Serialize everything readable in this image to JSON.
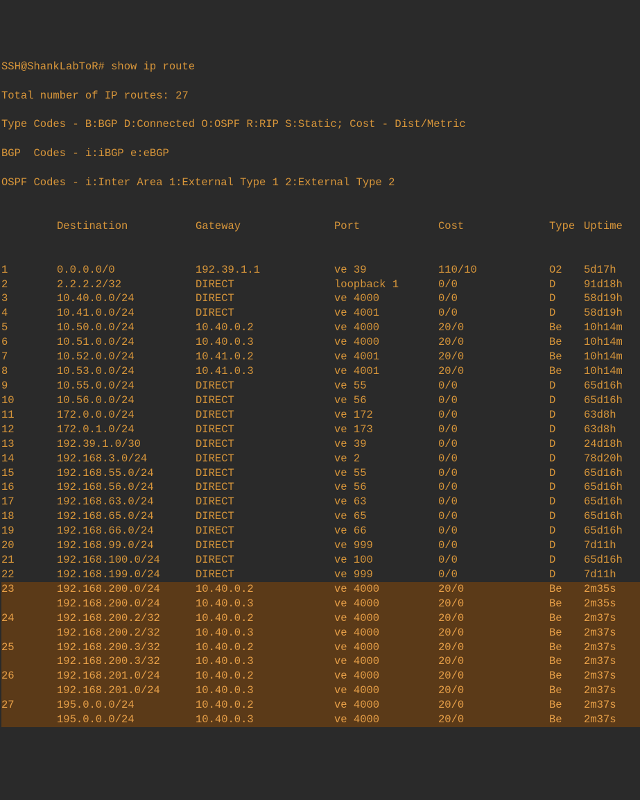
{
  "prompt": "SSH@ShankLabToR# show ip route",
  "header": [
    "Total number of IP routes: 27",
    "Type Codes - B:BGP D:Connected O:OSPF R:RIP S:Static; Cost - Dist/Metric",
    "BGP  Codes - i:iBGP e:eBGP",
    "OSPF Codes - i:Inter Area 1:External Type 1 2:External Type 2"
  ],
  "columns": {
    "idx": "",
    "dest": "Destination",
    "gw": "Gateway",
    "port": "Port",
    "cost": "Cost",
    "type": "Type",
    "up": "Uptime"
  },
  "routes": [
    {
      "idx": "1",
      "dest": "0.0.0.0/0",
      "gw": "192.39.1.1",
      "port": "ve 39",
      "cost": "110/10",
      "type": "O2",
      "up": "5d17h",
      "hl": false
    },
    {
      "idx": "2",
      "dest": "2.2.2.2/32",
      "gw": "DIRECT",
      "port": "loopback 1",
      "cost": "0/0",
      "type": "D",
      "up": "91d18h",
      "hl": false
    },
    {
      "idx": "3",
      "dest": "10.40.0.0/24",
      "gw": "DIRECT",
      "port": "ve 4000",
      "cost": "0/0",
      "type": "D",
      "up": "58d19h",
      "hl": false
    },
    {
      "idx": "4",
      "dest": "10.41.0.0/24",
      "gw": "DIRECT",
      "port": "ve 4001",
      "cost": "0/0",
      "type": "D",
      "up": "58d19h",
      "hl": false
    },
    {
      "idx": "5",
      "dest": "10.50.0.0/24",
      "gw": "10.40.0.2",
      "port": "ve 4000",
      "cost": "20/0",
      "type": "Be",
      "up": "10h14m",
      "hl": false
    },
    {
      "idx": "6",
      "dest": "10.51.0.0/24",
      "gw": "10.40.0.3",
      "port": "ve 4000",
      "cost": "20/0",
      "type": "Be",
      "up": "10h14m",
      "hl": false
    },
    {
      "idx": "7",
      "dest": "10.52.0.0/24",
      "gw": "10.41.0.2",
      "port": "ve 4001",
      "cost": "20/0",
      "type": "Be",
      "up": "10h14m",
      "hl": false
    },
    {
      "idx": "8",
      "dest": "10.53.0.0/24",
      "gw": "10.41.0.3",
      "port": "ve 4001",
      "cost": "20/0",
      "type": "Be",
      "up": "10h14m",
      "hl": false
    },
    {
      "idx": "9",
      "dest": "10.55.0.0/24",
      "gw": "DIRECT",
      "port": "ve 55",
      "cost": "0/0",
      "type": "D",
      "up": "65d16h",
      "hl": false
    },
    {
      "idx": "10",
      "dest": "10.56.0.0/24",
      "gw": "DIRECT",
      "port": "ve 56",
      "cost": "0/0",
      "type": "D",
      "up": "65d16h",
      "hl": false
    },
    {
      "idx": "11",
      "dest": "172.0.0.0/24",
      "gw": "DIRECT",
      "port": "ve 172",
      "cost": "0/0",
      "type": "D",
      "up": "63d8h",
      "hl": false
    },
    {
      "idx": "12",
      "dest": "172.0.1.0/24",
      "gw": "DIRECT",
      "port": "ve 173",
      "cost": "0/0",
      "type": "D",
      "up": "63d8h",
      "hl": false
    },
    {
      "idx": "13",
      "dest": "192.39.1.0/30",
      "gw": "DIRECT",
      "port": "ve 39",
      "cost": "0/0",
      "type": "D",
      "up": "24d18h",
      "hl": false
    },
    {
      "idx": "14",
      "dest": "192.168.3.0/24",
      "gw": "DIRECT",
      "port": "ve 2",
      "cost": "0/0",
      "type": "D",
      "up": "78d20h",
      "hl": false
    },
    {
      "idx": "15",
      "dest": "192.168.55.0/24",
      "gw": "DIRECT",
      "port": "ve 55",
      "cost": "0/0",
      "type": "D",
      "up": "65d16h",
      "hl": false
    },
    {
      "idx": "16",
      "dest": "192.168.56.0/24",
      "gw": "DIRECT",
      "port": "ve 56",
      "cost": "0/0",
      "type": "D",
      "up": "65d16h",
      "hl": false
    },
    {
      "idx": "17",
      "dest": "192.168.63.0/24",
      "gw": "DIRECT",
      "port": "ve 63",
      "cost": "0/0",
      "type": "D",
      "up": "65d16h",
      "hl": false
    },
    {
      "idx": "18",
      "dest": "192.168.65.0/24",
      "gw": "DIRECT",
      "port": "ve 65",
      "cost": "0/0",
      "type": "D",
      "up": "65d16h",
      "hl": false
    },
    {
      "idx": "19",
      "dest": "192.168.66.0/24",
      "gw": "DIRECT",
      "port": "ve 66",
      "cost": "0/0",
      "type": "D",
      "up": "65d16h",
      "hl": false
    },
    {
      "idx": "20",
      "dest": "192.168.99.0/24",
      "gw": "DIRECT",
      "port": "ve 999",
      "cost": "0/0",
      "type": "D",
      "up": "7d11h",
      "hl": false
    },
    {
      "idx": "21",
      "dest": "192.168.100.0/24",
      "gw": "DIRECT",
      "port": "ve 100",
      "cost": "0/0",
      "type": "D",
      "up": "65d16h",
      "hl": false
    },
    {
      "idx": "22",
      "dest": "192.168.199.0/24",
      "gw": "DIRECT",
      "port": "ve 999",
      "cost": "0/0",
      "type": "D",
      "up": "7d11h",
      "hl": false
    },
    {
      "idx": "23",
      "dest": "192.168.200.0/24",
      "gw": "10.40.0.2",
      "port": "ve 4000",
      "cost": "20/0",
      "type": "Be",
      "up": "2m35s",
      "hl": true
    },
    {
      "idx": "",
      "dest": "192.168.200.0/24",
      "gw": "10.40.0.3",
      "port": "ve 4000",
      "cost": "20/0",
      "type": "Be",
      "up": "2m35s",
      "hl": true
    },
    {
      "idx": "24",
      "dest": "192.168.200.2/32",
      "gw": "10.40.0.2",
      "port": "ve 4000",
      "cost": "20/0",
      "type": "Be",
      "up": "2m37s",
      "hl": true
    },
    {
      "idx": "",
      "dest": "192.168.200.2/32",
      "gw": "10.40.0.3",
      "port": "ve 4000",
      "cost": "20/0",
      "type": "Be",
      "up": "2m37s",
      "hl": true
    },
    {
      "idx": "25",
      "dest": "192.168.200.3/32",
      "gw": "10.40.0.2",
      "port": "ve 4000",
      "cost": "20/0",
      "type": "Be",
      "up": "2m37s",
      "hl": true
    },
    {
      "idx": "",
      "dest": "192.168.200.3/32",
      "gw": "10.40.0.3",
      "port": "ve 4000",
      "cost": "20/0",
      "type": "Be",
      "up": "2m37s",
      "hl": true
    },
    {
      "idx": "26",
      "dest": "192.168.201.0/24",
      "gw": "10.40.0.2",
      "port": "ve 4000",
      "cost": "20/0",
      "type": "Be",
      "up": "2m37s",
      "hl": true
    },
    {
      "idx": "",
      "dest": "192.168.201.0/24",
      "gw": "10.40.0.3",
      "port": "ve 4000",
      "cost": "20/0",
      "type": "Be",
      "up": "2m37s",
      "hl": true
    },
    {
      "idx": "27",
      "dest": "195.0.0.0/24",
      "gw": "10.40.0.2",
      "port": "ve 4000",
      "cost": "20/0",
      "type": "Be",
      "up": "2m37s",
      "hl": true
    },
    {
      "idx": "",
      "dest": "195.0.0.0/24",
      "gw": "10.40.0.3",
      "port": "ve 4000",
      "cost": "20/0",
      "type": "Be",
      "up": "2m37s",
      "hl": true
    }
  ]
}
